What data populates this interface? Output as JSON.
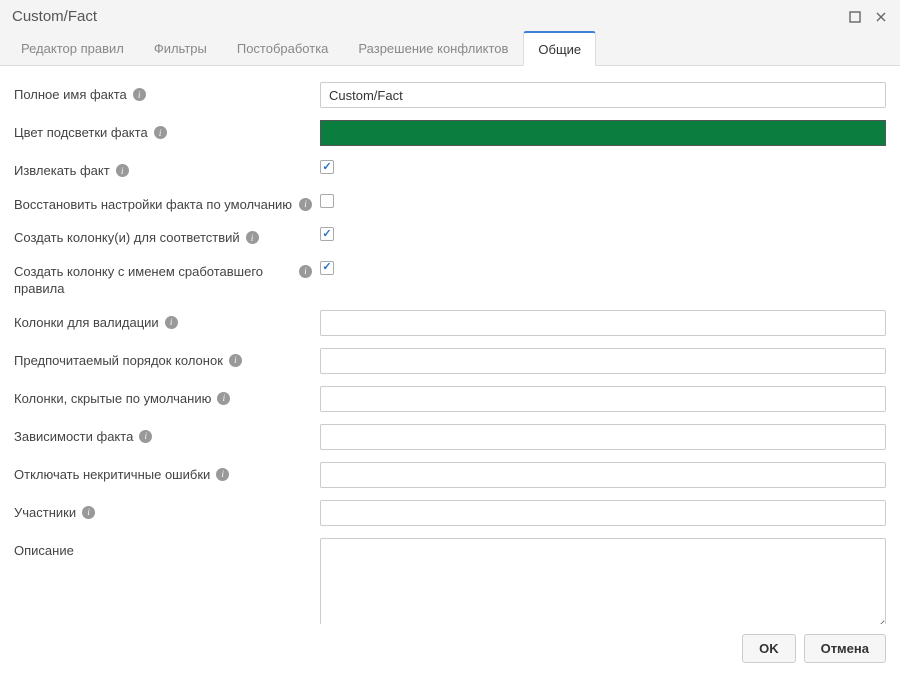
{
  "header": {
    "title": "Custom/Fact"
  },
  "tabs": [
    {
      "label": "Редактор правил",
      "active": false
    },
    {
      "label": "Фильтры",
      "active": false
    },
    {
      "label": "Постобработка",
      "active": false
    },
    {
      "label": "Разрешение конфликтов",
      "active": false
    },
    {
      "label": "Общие",
      "active": true
    }
  ],
  "fields": {
    "full_name": {
      "label": "Полное имя факта",
      "value": "Custom/Fact",
      "info": true
    },
    "highlight_color": {
      "label": "Цвет подсветки факта",
      "color": "#0b7d3e",
      "info": true
    },
    "extract_fact": {
      "label": "Извлекать факт",
      "checked": true,
      "info": true
    },
    "restore_defaults": {
      "label": "Восстановить настройки факта по умолчанию",
      "checked": false,
      "info": true
    },
    "create_match_cols": {
      "label": "Создать колонку(и) для соответствий",
      "checked": true,
      "info": true
    },
    "create_rule_col": {
      "label": "Создать колонку с именем сработавшего правила",
      "checked": true,
      "info": true
    },
    "validation_cols": {
      "label": "Колонки для валидации",
      "value": "",
      "info": true
    },
    "preferred_order": {
      "label": "Предпочитаемый порядок колонок",
      "value": "",
      "info": true
    },
    "hidden_cols": {
      "label": "Колонки, скрытые по умолчанию",
      "value": "",
      "info": true
    },
    "dependencies": {
      "label": "Зависимости факта",
      "value": "",
      "info": true
    },
    "suppress_noncrit": {
      "label": "Отключать некритичные ошибки",
      "value": "",
      "info": true
    },
    "participants": {
      "label": "Участники",
      "value": "",
      "info": true
    },
    "description": {
      "label": "Описание",
      "value": "",
      "info": false
    }
  },
  "footer": {
    "ok": "OK",
    "cancel": "Отмена"
  }
}
